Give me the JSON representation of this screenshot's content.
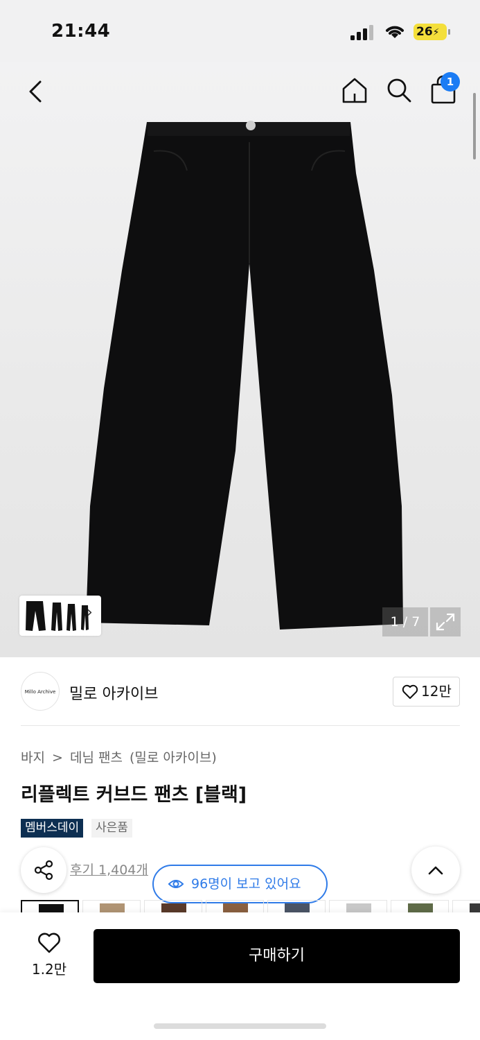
{
  "status_bar": {
    "time": "21:44",
    "battery": "26"
  },
  "nav": {
    "cart_count": "1"
  },
  "gallery": {
    "counter": "1 / 7",
    "thumb_arrow": "›"
  },
  "brand": {
    "logo_text": "Millo Archive",
    "name": "밀로 아카이브",
    "likes": "12만"
  },
  "breadcrumb": [
    "바지",
    ">",
    "데님 팬츠",
    "(밀로 아카이브)"
  ],
  "product": {
    "title": "리플렉트 커브드 팬츠 [블랙]",
    "tags": {
      "member": "멤버스데이",
      "gift": "사은품"
    },
    "reviews": "후기 1,404개",
    "viewers": "96명이 보고 있어요"
  },
  "swatch_colors": [
    "#111111",
    "#b09474",
    "#5a3a2a",
    "#8a6040",
    "#4b5566",
    "#c8c8c8",
    "#5f6b48",
    "#3a3a3a"
  ],
  "bottom": {
    "wish_count": "1.2만",
    "buy_label": "구매하기"
  },
  "colors": {
    "accent": "#2f7be8",
    "badge": "#1b7cf4",
    "member_tag": "#0d2f52"
  }
}
